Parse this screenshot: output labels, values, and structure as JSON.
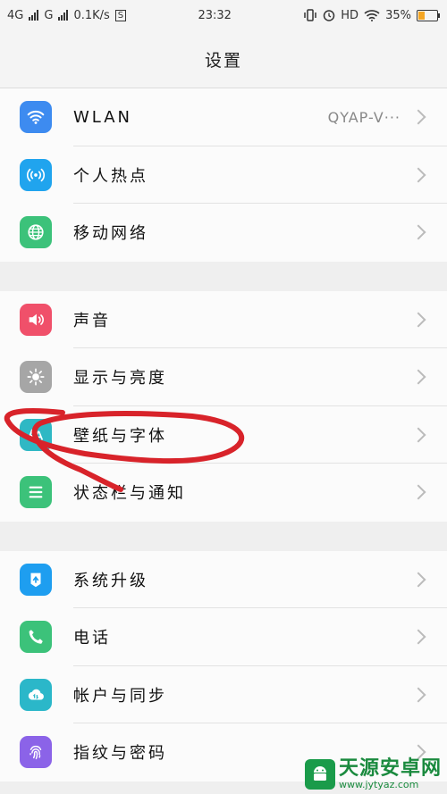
{
  "status": {
    "net1": "4G",
    "net2": "G",
    "speed": "0.1K/s",
    "s_badge": "S",
    "time": "23:32",
    "hd": "HD",
    "battery": "35%",
    "battery_level": 0.35
  },
  "header": {
    "title": "设置"
  },
  "groups": [
    {
      "items": [
        {
          "label": "WLAN",
          "value": "QYAP-V···",
          "icon": "wifi-icon",
          "color": "#3d8bf0"
        },
        {
          "label": "个人热点",
          "icon": "hotspot-icon",
          "color": "#20a4ee"
        },
        {
          "label": "移动网络",
          "icon": "globe-icon",
          "color": "#3cc27a"
        }
      ]
    },
    {
      "items": [
        {
          "label": "声音",
          "icon": "speaker-icon",
          "color": "#f0506a"
        },
        {
          "label": "显示与亮度",
          "icon": "sun-icon",
          "color": "#a6a6a6"
        },
        {
          "label": "壁纸与字体",
          "icon": "font-icon",
          "color": "#2fb8c4"
        },
        {
          "label": "状态栏与通知",
          "icon": "list-icon",
          "color": "#3cc27a"
        }
      ]
    },
    {
      "items": [
        {
          "label": "系统升级",
          "icon": "upgrade-icon",
          "color": "#1e9ef0"
        },
        {
          "label": "电话",
          "icon": "phone-icon",
          "color": "#3cc27a"
        },
        {
          "label": "帐户与同步",
          "icon": "cloud-icon",
          "color": "#2bb7c9"
        },
        {
          "label": "指纹与密码",
          "icon": "fingerprint-icon",
          "color": "#8b63e8"
        }
      ]
    }
  ],
  "watermark": {
    "title": "天源安卓网",
    "url": "www.jytyaz.com"
  }
}
